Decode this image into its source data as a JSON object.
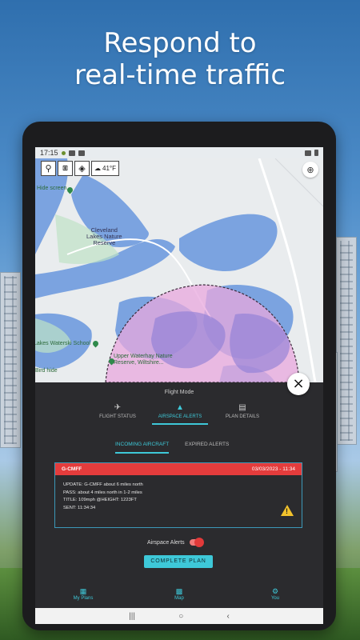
{
  "headline": {
    "line1": "Respond to",
    "line2": "real-time traffic"
  },
  "status_bar": {
    "time": "17:15"
  },
  "map": {
    "toolbar_icons": [
      "search-icon",
      "layers-3d-icon",
      "stack-icon"
    ],
    "weather_temp": "41°F",
    "labels": {
      "hide_screen": "Hide screen.",
      "cleveland": "Cleveland\nLakes Nature\nReserve",
      "waterski": "Lakes Waterski School",
      "upper_waterhay": "Upper Waterhay Nature\nReserve, Wiltshire...",
      "bird_hide": "Bird hide"
    },
    "colors": {
      "water": "#7ba3e0",
      "land": "#e9ecee",
      "green": "#bfe3c6",
      "zone": "#e8a8de"
    }
  },
  "panel": {
    "title": "Flight Mode",
    "mode_tabs": [
      {
        "label": "FLIGHT STATUS",
        "icon": "airplane-icon",
        "active": false
      },
      {
        "label": "AIRSPACE ALERTS",
        "icon": "alert-plane-icon",
        "active": true
      },
      {
        "label": "PLAN DETAILS",
        "icon": "document-icon",
        "active": false
      }
    ],
    "sub_tabs": [
      {
        "label": "INCOMING AIRCRAFT",
        "active": true
      },
      {
        "label": "EXPIRED ALERTS",
        "active": false
      }
    ],
    "alert": {
      "callsign": "G-CMFF",
      "datetime": "03/03/2023 - 11:34",
      "lines": [
        "UPDATE: G-CMFF about 6 miles north",
        "PASS: about 4 miles north in 1-2 miles",
        "TITLE: 109mph @HEIGHT: 1223FT",
        "SENT: 11:34:34"
      ]
    },
    "toggle_label": "Airspace Alerts",
    "toggle_on": true,
    "complete_button": "COMPLETE PLAN"
  },
  "bottom_nav": [
    {
      "label": "My Plans",
      "icon": "clipboard-icon"
    },
    {
      "label": "Map",
      "icon": "map-icon"
    },
    {
      "label": "You",
      "icon": "gear-icon"
    }
  ],
  "android_nav": {
    "recent": "|||",
    "home": "○",
    "back": "‹"
  },
  "accent_color": "#3ec8d8",
  "alert_color": "#e43c3c"
}
